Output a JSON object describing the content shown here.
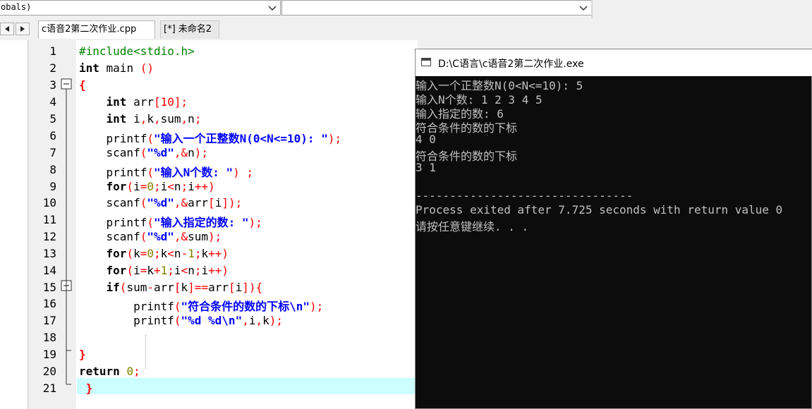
{
  "toolbar": {
    "combo1_value": "obals)",
    "combo2_value": ""
  },
  "tabs": [
    {
      "label": "c语音2第二次作业.cpp",
      "active": true
    },
    {
      "label": "[*] 未命名2",
      "active": false
    }
  ],
  "editor": {
    "line_numbers": [
      "1",
      "2",
      "3",
      "4",
      "5",
      "6",
      "7",
      "8",
      "9",
      "10",
      "11",
      "12",
      "13",
      "14",
      "15",
      "16",
      "17",
      "18",
      "19",
      "20",
      "21"
    ],
    "current_line": 21
  },
  "console": {
    "title": "D:\\C语言\\c语音2第二次作业.exe",
    "lines": [
      "输入一个正整数N(0<N<=10): 5",
      "输入N个数: 1 2 3 4 5",
      "输入指定的数: 6",
      "符合条件的数的下标",
      "4 0",
      "符合条件的数的下标",
      "3 1",
      "",
      "--------------------------------",
      "Process exited after 7.725 seconds with return value 0",
      "请按任意键继续. . ."
    ]
  },
  "icons": {
    "combo_arrow": "chevron-down-icon",
    "nav_left": "triangle-left-icon",
    "nav_right": "triangle-right-icon",
    "fold": "fold-minus-icon",
    "console": "console-window-icon"
  }
}
